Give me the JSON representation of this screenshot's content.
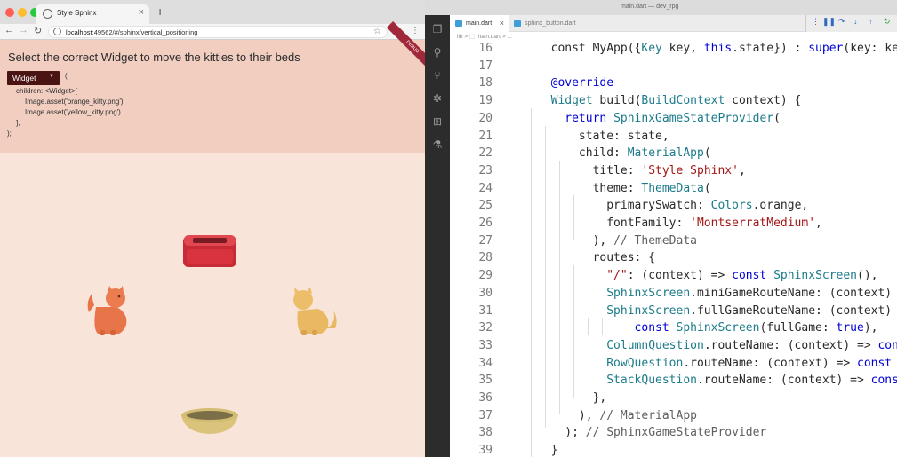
{
  "browser": {
    "tab_title": "Style Sphinx",
    "address": "localhost:49562/#/sphinx/vertical_positioning",
    "address_host": "localhost",
    "address_rest": ":49562/#/sphinx/vertical_positioning"
  },
  "question": {
    "title": "Select the correct Widget to move the kitties to their beds",
    "select_value": "Widget",
    "code_lines": [
      "(",
      "children: <Widget>[",
      "Image.asset('orange_kitty.png')",
      "Image.asset('yellow_kitty.png')",
      "],",
      ");"
    ]
  },
  "ribbon": {
    "label": "DEBUG"
  },
  "editor": {
    "window_title": "main.dart — dev_rpg",
    "tabs": [
      {
        "label": "main.dart"
      },
      {
        "label": "sphinx_button.dart"
      }
    ],
    "breadcrumb": "lib > ⬚ main.dart > ...",
    "line_numbers": [
      "16",
      "17",
      "18",
      "19",
      "20",
      "21",
      "22",
      "23",
      "24",
      "25",
      "26",
      "27",
      "28",
      "29",
      "30",
      "31",
      "32",
      "33",
      "34",
      "35",
      "36",
      "37",
      "38",
      "39"
    ]
  },
  "colors": {
    "question_bg": "#f1cec0",
    "game_bg": "#f9e4da",
    "select_bg": "#4a1412",
    "bed_red": "#d9343e",
    "orange_kitty": "#e8744a",
    "yellow_kitty": "#e9b863",
    "bowl": "#dac37a",
    "keyword": "#0000d6",
    "type": "#1b7b8a",
    "string": "#a31515"
  }
}
